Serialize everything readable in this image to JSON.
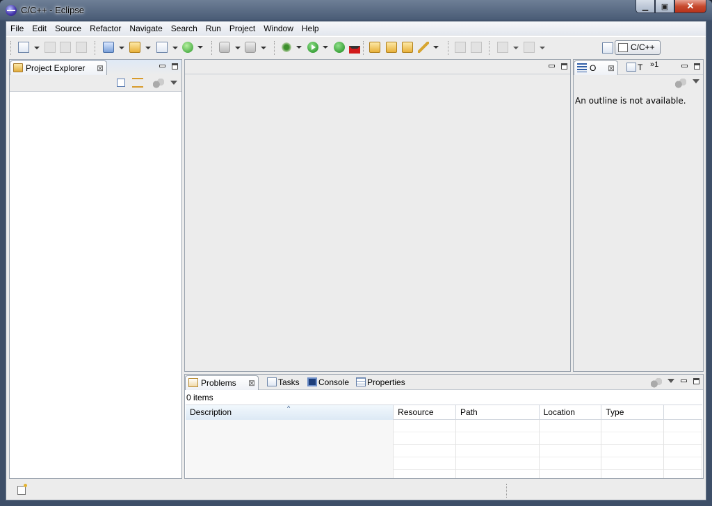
{
  "window": {
    "title": "C/C++ - Eclipse"
  },
  "menubar": {
    "items": [
      "File",
      "Edit",
      "Source",
      "Refactor",
      "Navigate",
      "Search",
      "Run",
      "Project",
      "Window",
      "Help"
    ]
  },
  "perspective": {
    "label": "C/C++",
    "icon": "c-perspective-icon"
  },
  "project_explorer": {
    "tab_label": "Project Explorer",
    "icon": "folder-icon"
  },
  "outline": {
    "tab_label": "O",
    "second_tab_label": "T",
    "overflow_label": "»1",
    "message": "An outline is not available."
  },
  "bottom_panel": {
    "tabs": [
      {
        "label": "Problems",
        "icon": "problems-icon",
        "active": true
      },
      {
        "label": "Tasks",
        "icon": "tasks-icon",
        "active": false
      },
      {
        "label": "Console",
        "icon": "console-icon",
        "active": false
      },
      {
        "label": "Properties",
        "icon": "properties-icon",
        "active": false
      }
    ],
    "item_count": "0 items",
    "columns": [
      "Description",
      "Resource",
      "Path",
      "Location",
      "Type"
    ],
    "sorted_column": "Description",
    "empty_rows": 5
  }
}
